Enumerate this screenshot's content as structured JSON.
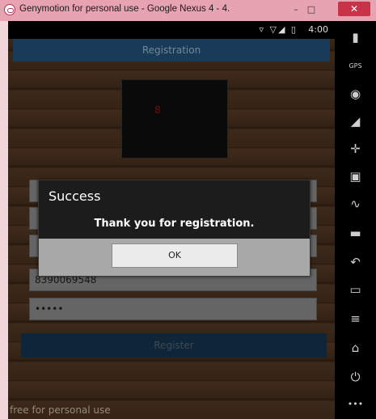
{
  "window": {
    "title": "Genymotion for personal use - Google Nexus 4 - 4.",
    "min_label": "–",
    "max_label": "□",
    "close_label": "✕"
  },
  "status": {
    "icons": "▿ ▽◢ ▯",
    "time": "4:00"
  },
  "app": {
    "title": "Registration",
    "photo_glyph": "8",
    "fields": [
      "",
      "",
      "",
      "8390069548",
      "•••••"
    ],
    "register_label": "Register",
    "watermark": "free for personal use"
  },
  "dialog": {
    "title": "Success",
    "message": "Thank you for registration.",
    "ok_label": "OK"
  },
  "sidebar": {
    "items": [
      {
        "name": "battery-icon",
        "glyph": "▮"
      },
      {
        "name": "gps-icon",
        "glyph": "GPS"
      },
      {
        "name": "camera-icon",
        "glyph": "◉"
      },
      {
        "name": "remote-control-icon",
        "glyph": "◢"
      },
      {
        "name": "dpad-icon",
        "glyph": "✛"
      },
      {
        "name": "id-icon",
        "glyph": "▣"
      },
      {
        "name": "cast-icon",
        "glyph": "∿"
      },
      {
        "name": "sms-icon",
        "glyph": "▬"
      },
      {
        "name": "back-icon",
        "glyph": "↶"
      },
      {
        "name": "recent-apps-icon",
        "glyph": "▭"
      },
      {
        "name": "menu-icon",
        "glyph": "≡"
      },
      {
        "name": "home-icon",
        "glyph": "⌂"
      },
      {
        "name": "power-icon",
        "glyph": "⏻"
      },
      {
        "name": "more-icon",
        "glyph": "•••"
      }
    ]
  }
}
